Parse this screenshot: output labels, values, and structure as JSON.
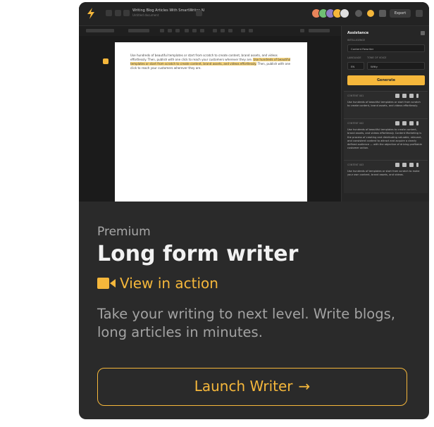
{
  "app_screenshot": {
    "doc_title": "Writing Blog Articles With SmartWriter AI",
    "doc_subtitle": "Untitled document",
    "export_label": "Export",
    "avatar_colors": [
      "#e8845a",
      "#6fbf73",
      "#8e7cc3",
      "#f5b73b",
      "#e0e0e0"
    ],
    "document_text_before": "Use hundreds of beautiful templates or start from scratch to create content, brand assets, and videos effortlessly. Then, publish with one click to reach your customers wherever they are.",
    "document_text_highlight": "Use hundreds of beautiful templates or start from scratch to create content, brand assets, and videos effortlessly.",
    "document_text_after": "Then, publish with one click to reach your customers wherever they are.",
    "panel": {
      "title": "Assistance",
      "section_label": "INTELLIGENCE",
      "mode_value": "Content Rewriter",
      "language_label": "LANGUAGE",
      "tone_label": "TONE OF VOICE",
      "language_value": "EN",
      "tone_value": "Witty",
      "generate_label": "Generate",
      "results": [
        {
          "head": "CONTENT 001",
          "text": "Use hundreds of beautiful templates or start from scratch to create content, brand assets, and videos effortlessly."
        },
        {
          "head": "CONTENT 002",
          "text": "Use hundreds of beautiful templates to create content, brand assets, and videos effortlessly. Content Marketing is the process of creating and distributing valuable, relevant, and consistent content to attract and acquire a clearly defined audience — with the objective of driving profitable customer action."
        },
        {
          "head": "CONTENT 003",
          "text": "Use hundreds of templates or start from scratch to make your own content, brand assets, and videos."
        }
      ]
    }
  },
  "card": {
    "tier": "Premium",
    "title": "Long form writer",
    "video_link": "View in action",
    "description": "Take your writing to next level. Write blogs, long articles in minutes.",
    "launch_label": "Launch Writer",
    "launch_arrow": "→",
    "accent_color": "#f5b73b"
  }
}
